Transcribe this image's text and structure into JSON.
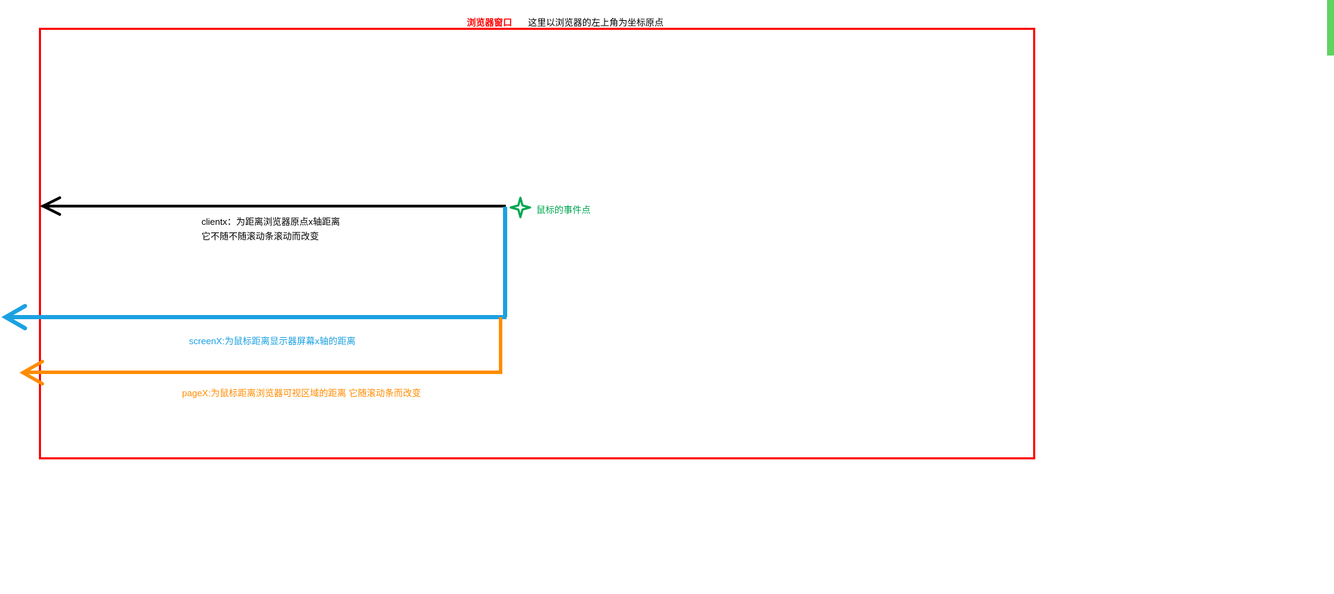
{
  "labels": {
    "browser_window": "浏览器窗口",
    "origin_note": "这里以浏览器的左上角为坐标原点",
    "mouse_event_point": "鼠标的事件点",
    "clientx": "clientx：为距离浏览器原点x轴距离   它不随不随滚动条滚动而改变",
    "screenx": "screenX:为鼠标距离显示器屏幕x轴的距离",
    "pagex": "pageX:为鼠标距离浏览器可视区域的距离 它随滚动条而改变"
  },
  "colors": {
    "browser_border": "#ff0000",
    "clientx_arrow": "#000000",
    "screenx_arrow": "#1ba1e2",
    "pagex_arrow": "#ff8c00",
    "mouse_point": "#00a651"
  },
  "diagram": {
    "type": "coordinate-system-explanation",
    "concepts": [
      {
        "name": "clientX",
        "desc": "distance from browser origin x-axis, does not change with scroll"
      },
      {
        "name": "screenX",
        "desc": "distance from monitor screen x-axis"
      },
      {
        "name": "pageX",
        "desc": "distance from browser visible area, changes with scroll"
      }
    ]
  }
}
